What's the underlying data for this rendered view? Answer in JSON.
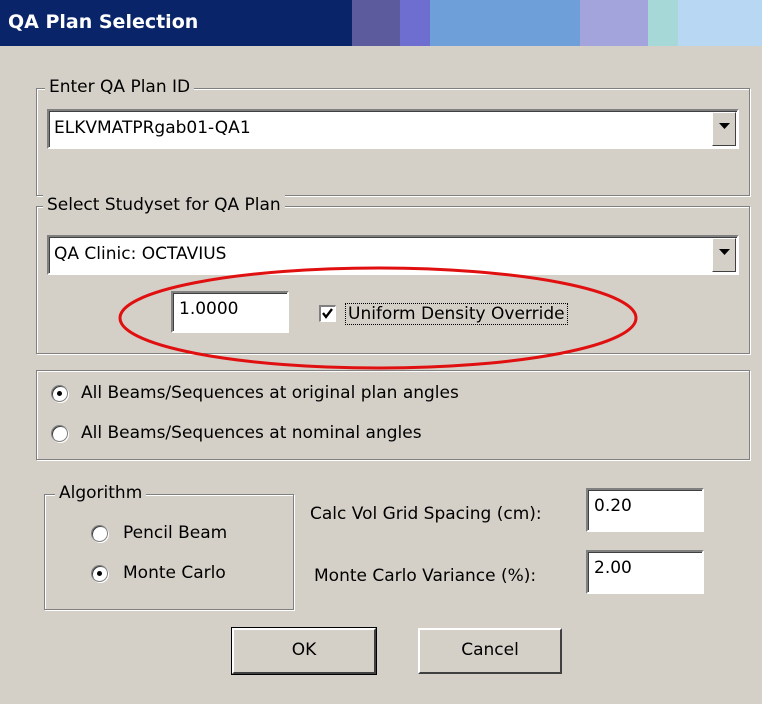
{
  "window": {
    "title": "QA Plan Selection",
    "titlebar_colors": [
      "#0a246a",
      "#3a6ea5",
      "#5b5b9e",
      "#6e6ed0",
      "#6f9fd8",
      "#8bb4e0",
      "#a4a4dc",
      "#a6d8d8",
      "#b7d7f2"
    ]
  },
  "plan_id_group": {
    "legend": "Enter QA Plan ID",
    "value": "ELKVMATPRgab01-QA1"
  },
  "studyset_group": {
    "legend": "Select Studyset for QA Plan",
    "value": "QA Clinic:  OCTAVIUS",
    "density_value": "1.0000",
    "density_override_label": "Uniform Density Override",
    "density_override_checked": true,
    "annotation_color": "#e01010"
  },
  "angles_group": {
    "options": [
      {
        "label": "All Beams/Sequences at original plan angles",
        "selected": true
      },
      {
        "label": "All Beams/Sequences at nominal angles",
        "selected": false
      }
    ]
  },
  "algorithm_group": {
    "legend": "Algorithm",
    "options": [
      {
        "label": "Pencil Beam",
        "selected": false
      },
      {
        "label": "Monte Carlo",
        "selected": true
      }
    ]
  },
  "calc_settings": {
    "grid_spacing_label": "Calc Vol Grid Spacing (cm):",
    "grid_spacing_value": "0.20",
    "variance_label": "Monte Carlo Variance (%):",
    "variance_value": "2.00"
  },
  "buttons": {
    "ok_label": "OK",
    "cancel_label": "Cancel"
  }
}
